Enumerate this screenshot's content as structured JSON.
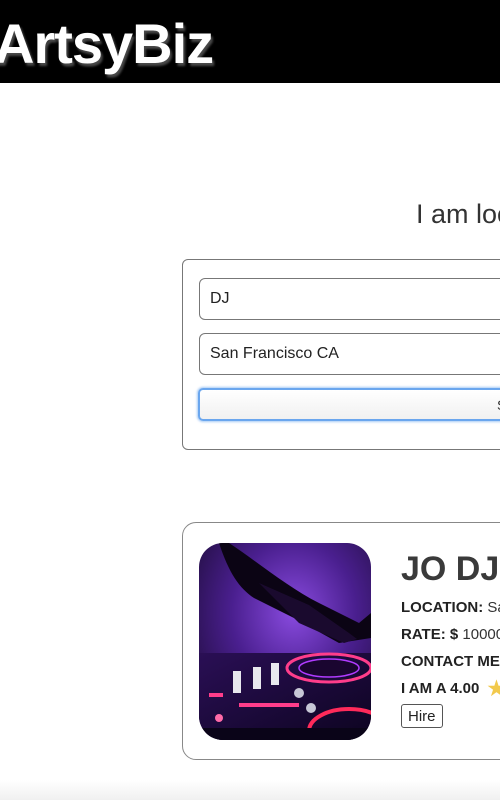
{
  "header": {
    "logo": "ArtsyBiz",
    "background": "#000000"
  },
  "search": {
    "heading": "I am loo",
    "what_value": "DJ",
    "where_value": "San Francisco CA",
    "button_label": "S"
  },
  "result": {
    "name": "JO DJ",
    "location_label": "LOCATION:",
    "location_value": "Sa",
    "rate_label": "RATE: $",
    "rate_value": "10000",
    "contact_label": "CONTACT ME",
    "rating_text": "I AM A 4.00",
    "rating_icon": "star-icon",
    "hire_label": "Hire",
    "accent_color": "#f2c94c"
  }
}
